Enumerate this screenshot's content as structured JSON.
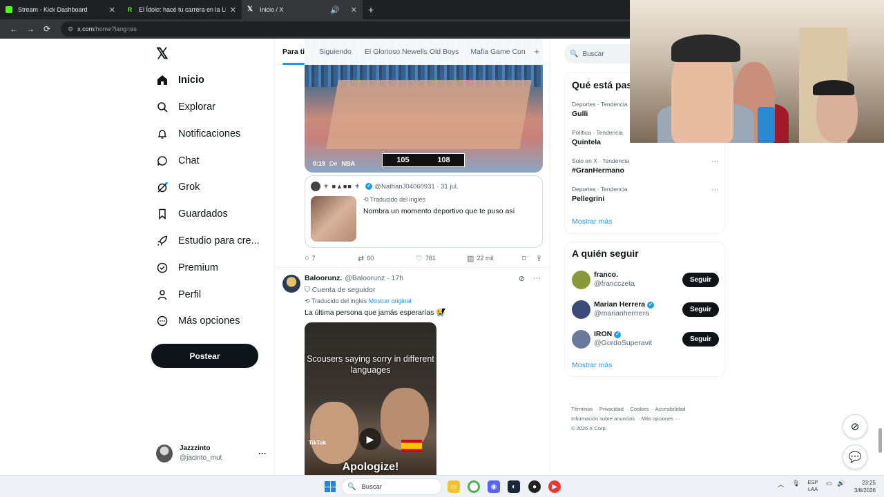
{
  "browser": {
    "tabs": [
      {
        "label": "Stream - Kick Dashboard",
        "color": "#53fc18"
      },
      {
        "label": "El Ídolo: hacé tu carrera en la Li",
        "color": "#53fc18"
      },
      {
        "label": "Inicio / X",
        "color": "#ffffff"
      }
    ],
    "active_tab": 2,
    "url_host": "x.com",
    "url_path": "/home?lang=es"
  },
  "sidebar": {
    "items": [
      {
        "label": "Inicio",
        "icon": "home-icon"
      },
      {
        "label": "Explorar",
        "icon": "search-icon"
      },
      {
        "label": "Notificaciones",
        "icon": "bell-icon"
      },
      {
        "label": "Chat",
        "icon": "chat-icon"
      },
      {
        "label": "Grok",
        "icon": "grok-icon"
      },
      {
        "label": "Guardados",
        "icon": "bookmark-icon"
      },
      {
        "label": "Estudio para cre...",
        "icon": "rocket-icon"
      },
      {
        "label": "Premium",
        "icon": "premium-icon"
      },
      {
        "label": "Perfil",
        "icon": "person-icon"
      },
      {
        "label": "Más opciones",
        "icon": "more-icon"
      }
    ],
    "post_label": "Postear",
    "user": {
      "name": "Jazzzinto",
      "handle": "@jacinto_mut"
    }
  },
  "timeline": {
    "tabs": [
      "Para ti",
      "Siguiendo",
      "El Glorioso Newells Old Boys",
      "Mafia Game Con"
    ],
    "post1": {
      "video_time": "0:19",
      "video_from": "De",
      "video_source": "NBA",
      "score_left": "105",
      "score_right": "108",
      "quote_emojis": "⚜ ■▲■■ ⚜",
      "quote_handle": "@NathanJ04060931",
      "quote_date": "31 jul.",
      "quote_translated": "Traducido del inglés",
      "quote_text": "Nombra un momento deportivo que te puso así",
      "replies": "7",
      "reposts": "60",
      "likes": "781",
      "views": "22 mil"
    },
    "post2": {
      "name": "Baloorunz.",
      "handle": "@Baloorunz",
      "time": "17h",
      "subtitle": "Cuenta de seguidor",
      "translated": "Traducido del inglés",
      "original_link": "Mostrar original",
      "text": "La última persona que jamás esperarías 😭",
      "video_caption": "Scousers saying sorry in different languages",
      "video_bottom": "Apologize!",
      "tiktok": "TikTok"
    }
  },
  "right": {
    "search_placeholder": "Buscar",
    "trends_title": "Qué está pas",
    "trends": [
      {
        "meta": "Deportes · Tendencia",
        "name": "Gulli"
      },
      {
        "meta": "Política · Tendencia",
        "name": "Quintela"
      },
      {
        "meta": "Solo en X · Tendencia",
        "name": "#GranHermano"
      },
      {
        "meta": "Deportes · Tendencia",
        "name": "Pellegrini"
      }
    ],
    "show_more": "Mostrar más",
    "who_title": "A quién seguir",
    "who": [
      {
        "name": "franco.",
        "handle": "@francczeta",
        "verified": false,
        "avatar_color": "#8a9a3a"
      },
      {
        "name": "Marian Herrera",
        "handle": "@marianherrrera",
        "verified": true,
        "avatar_color": "#3a4a7a"
      },
      {
        "name": "IRON",
        "handle": "@GordoSuperavit",
        "verified": true,
        "avatar_color": "#6a7a9a"
      }
    ],
    "follow_label": "Seguir",
    "footer_links": [
      "Términos",
      "Privacidad",
      "Cookies",
      "Accesibilidad",
      "Información sobre anuncios",
      "Más opciones ···"
    ],
    "copyright": "© 2026 X Corp."
  },
  "taskbar": {
    "search_label": "Buscar",
    "lang_top": "ESP",
    "lang_bottom": "LAA",
    "time": "23:25",
    "date": "3/8/2026"
  }
}
